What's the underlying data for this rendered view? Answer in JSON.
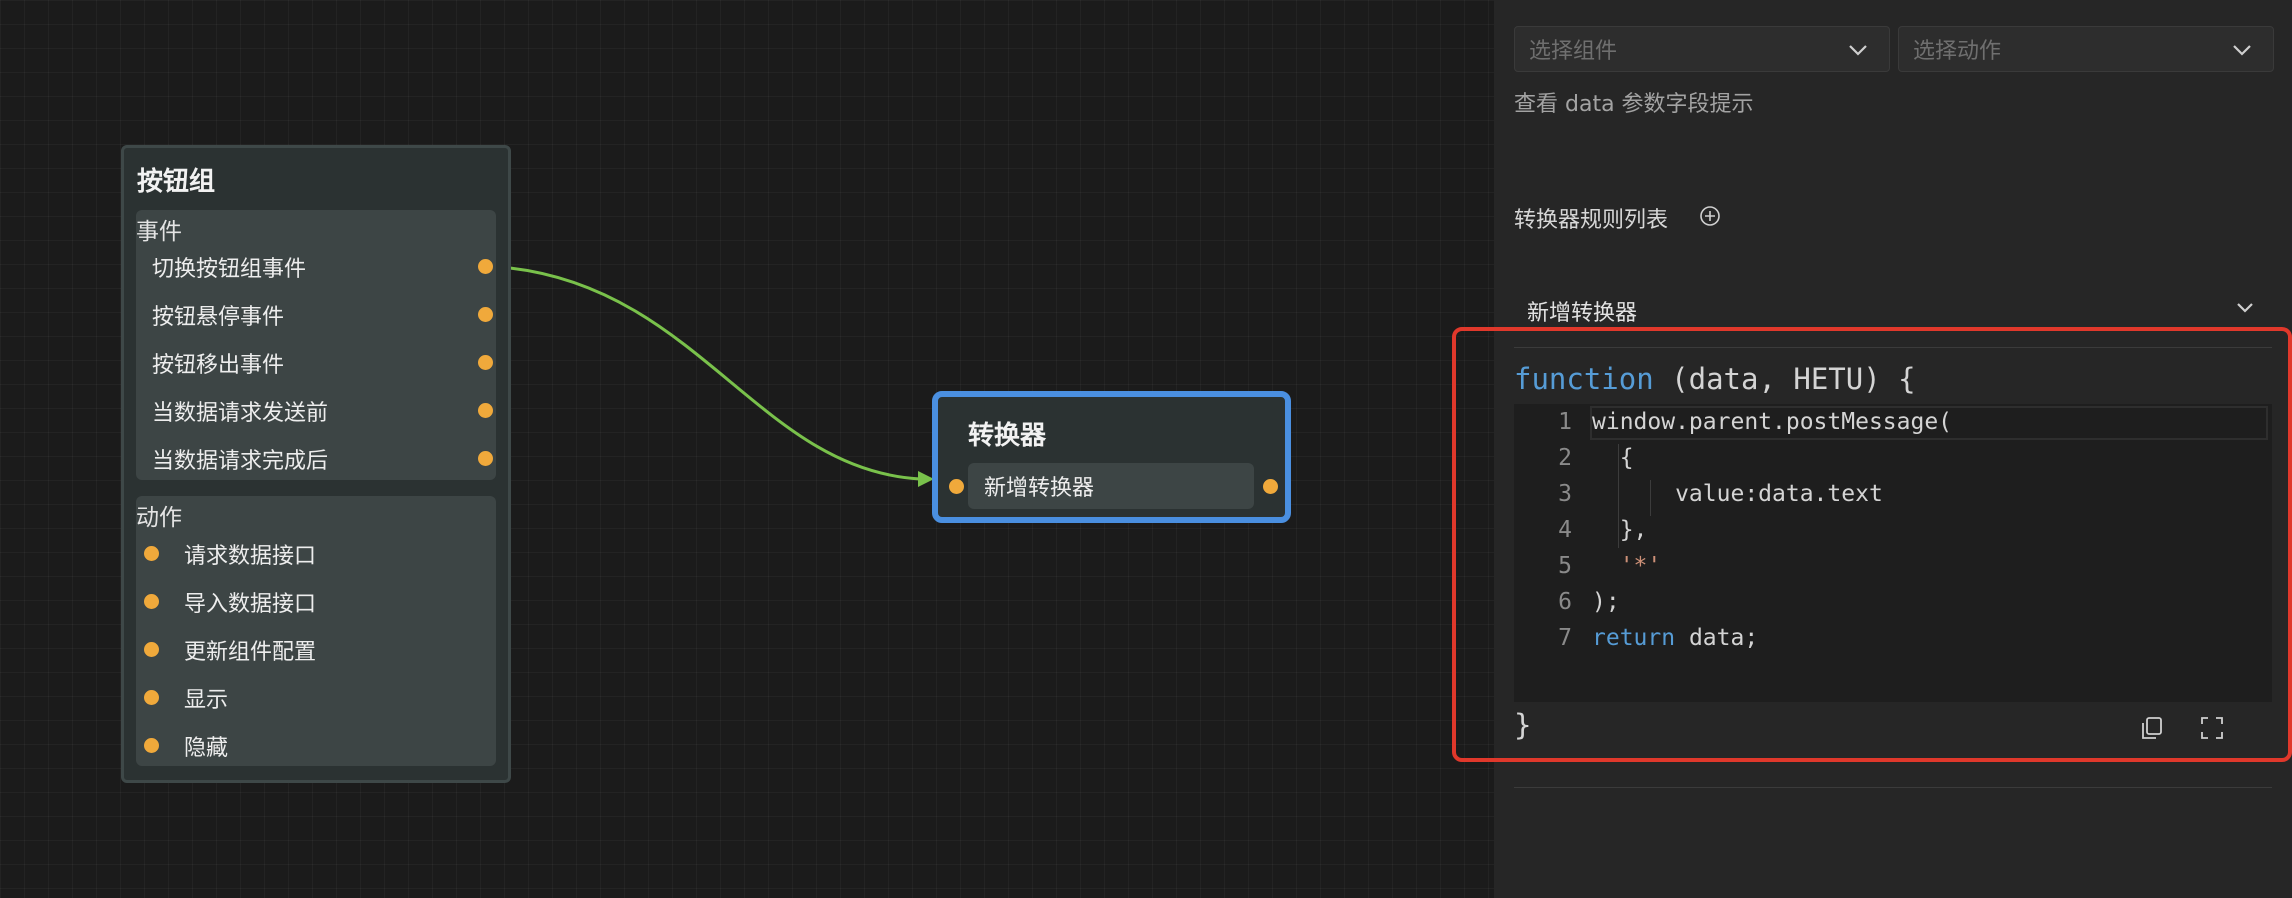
{
  "canvas": {
    "button_group_node": {
      "title": "按钮组",
      "events_label": "事件",
      "events": [
        "切换按钮组事件",
        "按钮悬停事件",
        "按钮移出事件",
        "当数据请求发送前",
        "当数据请求完成后"
      ],
      "actions_label": "动作",
      "actions": [
        "请求数据接口",
        "导入数据接口",
        "更新组件配置",
        "显示",
        "隐藏"
      ]
    },
    "converter_node": {
      "title": "转换器",
      "item": "新增转换器"
    },
    "colors": {
      "edge": "#79c14b",
      "port": "#f0a93b",
      "selected_border": "#4a8fe0"
    }
  },
  "panel": {
    "select_component": {
      "placeholder": "选择组件"
    },
    "select_action": {
      "placeholder": "选择动作"
    },
    "data_hint_link": "查看 data 参数字段提示",
    "converter_rules_title": "转换器规则列表",
    "converter_rule_name": "新增转换器",
    "code": {
      "header": {
        "keyword": "function",
        "params": " (data, HETU) {"
      },
      "lines": [
        {
          "num": "1",
          "text": "window.parent.postMessage("
        },
        {
          "num": "2",
          "text": "  {"
        },
        {
          "num": "3",
          "text": "      value:data.text"
        },
        {
          "num": "4",
          "text": "  },"
        },
        {
          "num": "5",
          "text": "  '*'"
        },
        {
          "num": "6",
          "text": ");"
        },
        {
          "num": "7",
          "keyword": "return",
          "text": " data;"
        }
      ],
      "footer": "}"
    },
    "highlight_color": "#e0382b"
  }
}
